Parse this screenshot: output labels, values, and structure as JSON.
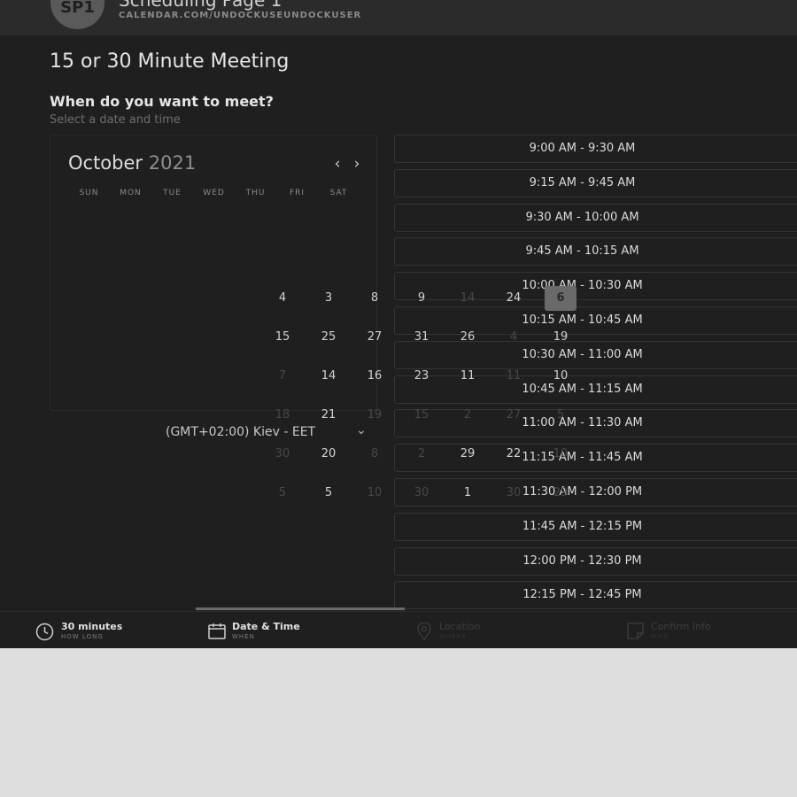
{
  "header": {
    "avatar_initials": "SP1",
    "page_name": "Scheduling Page 1",
    "url": "CALENDAR.COM/UNDOCKUSEUNDOCKUSER"
  },
  "event_title": "15 or 30 Minute Meeting",
  "prompt": {
    "question": "When do you want to meet?",
    "hint": "Select a date and time"
  },
  "calendar": {
    "month": "October",
    "year": "2021",
    "prev_icon": "chevron-left-icon",
    "next_icon": "chevron-right-icon",
    "weekdays": [
      "SUN",
      "MON",
      "TUE",
      "WED",
      "THU",
      "FRI",
      "SAT"
    ],
    "days": [
      {
        "label": "4",
        "available": true
      },
      {
        "label": "3",
        "available": true
      },
      {
        "label": "8",
        "available": true
      },
      {
        "label": "9",
        "available": true
      },
      {
        "label": "14",
        "available": false
      },
      {
        "label": "24",
        "available": true
      },
      {
        "label": "6",
        "available": true,
        "selected": true
      },
      {
        "label": "15",
        "available": true
      },
      {
        "label": "25",
        "available": true
      },
      {
        "label": "27",
        "available": true
      },
      {
        "label": "31",
        "available": true
      },
      {
        "label": "26",
        "available": true
      },
      {
        "label": "4",
        "available": false
      },
      {
        "label": "19",
        "available": true
      },
      {
        "label": "7",
        "available": false
      },
      {
        "label": "14",
        "available": true
      },
      {
        "label": "16",
        "available": true
      },
      {
        "label": "23",
        "available": true
      },
      {
        "label": "11",
        "available": true
      },
      {
        "label": "11",
        "available": false
      },
      {
        "label": "10",
        "available": true
      },
      {
        "label": "18",
        "available": false
      },
      {
        "label": "21",
        "available": true
      },
      {
        "label": "19",
        "available": false
      },
      {
        "label": "15",
        "available": false
      },
      {
        "label": "2",
        "available": false
      },
      {
        "label": "27",
        "available": false
      },
      {
        "label": "5",
        "available": false
      },
      {
        "label": "30",
        "available": false
      },
      {
        "label": "20",
        "available": true
      },
      {
        "label": "8",
        "available": false
      },
      {
        "label": "2",
        "available": false
      },
      {
        "label": "29",
        "available": true
      },
      {
        "label": "22",
        "available": true
      },
      {
        "label": "10",
        "available": false
      },
      {
        "label": "5",
        "available": false
      },
      {
        "label": "5",
        "available": true
      },
      {
        "label": "10",
        "available": false
      },
      {
        "label": "30",
        "available": false
      },
      {
        "label": "1",
        "available": true
      },
      {
        "label": "30",
        "available": false
      },
      {
        "label": "29",
        "available": false
      }
    ]
  },
  "timezone": {
    "label": "(GMT+02:00) Kiev - EET",
    "dropdown_icon": "chevron-down-icon"
  },
  "time_slots": [
    "9:00 AM - 9:30 AM",
    "9:15 AM - 9:45 AM",
    "9:30 AM - 10:00 AM",
    "9:45 AM - 10:15 AM",
    "10:00 AM - 10:30 AM",
    "10:15 AM - 10:45 AM",
    "10:30 AM - 11:00 AM",
    "10:45 AM - 11:15 AM",
    "11:00 AM - 11:30 AM",
    "11:15 AM - 11:45 AM",
    "11:30 AM - 12:00 PM",
    "11:45 AM - 12:15 PM",
    "12:00 PM - 12:30 PM",
    "12:15 PM - 12:45 PM"
  ],
  "steps": [
    {
      "title": "30 minutes",
      "subtitle": "HOW LONG",
      "icon": "clock-icon",
      "state": "done"
    },
    {
      "title": "Date & Time",
      "subtitle": "WHEN",
      "icon": "calendar-icon",
      "state": "active"
    },
    {
      "title": "Location",
      "subtitle": "WHERE",
      "icon": "location-pin-icon",
      "state": "inactive"
    },
    {
      "title": "Confirm Info",
      "subtitle": "WHO",
      "icon": "note-icon",
      "state": "inactive"
    }
  ]
}
